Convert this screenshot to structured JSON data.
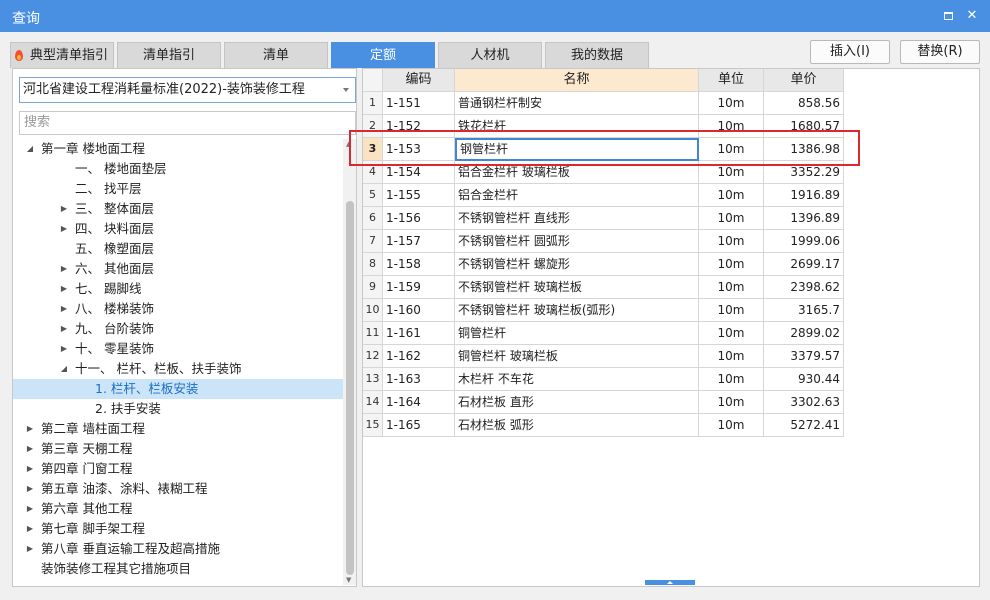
{
  "window": {
    "title": "查询",
    "maximize_icon": "maximize-icon",
    "close_icon": "close-icon",
    "close_glyph": "✕"
  },
  "tabs": [
    {
      "label": "典型清单指引",
      "icon": "fire-icon"
    },
    {
      "label": "清单指引"
    },
    {
      "label": "清单"
    },
    {
      "label": "定额",
      "active": true
    },
    {
      "label": "人材机"
    },
    {
      "label": "我的数据"
    }
  ],
  "actions": {
    "insert": "插入(I)",
    "replace": "替换(R)"
  },
  "left": {
    "standard_select": "河北省建设工程消耗量标准(2022)-装饰装修工程",
    "search_placeholder": "搜索",
    "tree": [
      {
        "label": "第一章 楼地面工程",
        "arrow": "expanded"
      },
      {
        "label": "一、 楼地面垫层",
        "arrow": "none"
      },
      {
        "label": "二、 找平层",
        "arrow": "none"
      },
      {
        "label": "三、 整体面层",
        "arrow": "collapsed"
      },
      {
        "label": "四、 块料面层",
        "arrow": "collapsed"
      },
      {
        "label": "五、 橡塑面层",
        "arrow": "none"
      },
      {
        "label": "六、 其他面层",
        "arrow": "collapsed"
      },
      {
        "label": "七、 踢脚线",
        "arrow": "collapsed"
      },
      {
        "label": "八、 楼梯装饰",
        "arrow": "collapsed"
      },
      {
        "label": "九、 台阶装饰",
        "arrow": "collapsed"
      },
      {
        "label": "十、 零星装饰",
        "arrow": "collapsed"
      },
      {
        "label": "十一、 栏杆、栏板、扶手装饰",
        "arrow": "expanded"
      },
      {
        "label": "1. 栏杆、栏板安装",
        "arrow": "none",
        "selected": true
      },
      {
        "label": "2. 扶手安装",
        "arrow": "none"
      },
      {
        "label": "第二章 墙柱面工程",
        "arrow": "collapsed"
      },
      {
        "label": "第三章 天棚工程",
        "arrow": "collapsed"
      },
      {
        "label": "第四章 门窗工程",
        "arrow": "collapsed"
      },
      {
        "label": "第五章 油漆、涂料、裱糊工程",
        "arrow": "collapsed"
      },
      {
        "label": "第六章 其他工程",
        "arrow": "collapsed"
      },
      {
        "label": "第七章 脚手架工程",
        "arrow": "collapsed"
      },
      {
        "label": "第八章 垂直运输工程及超高措施",
        "arrow": "collapsed"
      },
      {
        "label": "装饰装修工程其它措施项目",
        "arrow": "none"
      }
    ]
  },
  "table": {
    "headers": {
      "code": "编码",
      "name": "名称",
      "unit": "单位",
      "price": "单价"
    },
    "current_row": 3,
    "rows": [
      {
        "idx": "1",
        "code": "1-151",
        "name": "普通钢栏杆制安",
        "unit": "10m",
        "price": "858.56"
      },
      {
        "idx": "2",
        "code": "1-152",
        "name": "铁花栏杆",
        "unit": "10m",
        "price": "1680.57"
      },
      {
        "idx": "3",
        "code": "1-153",
        "name": "钢管栏杆",
        "unit": "10m",
        "price": "1386.98"
      },
      {
        "idx": "4",
        "code": "1-154",
        "name": "铝合金栏杆 玻璃栏板",
        "unit": "10m",
        "price": "3352.29"
      },
      {
        "idx": "5",
        "code": "1-155",
        "name": "铝合金栏杆",
        "unit": "10m",
        "price": "1916.89"
      },
      {
        "idx": "6",
        "code": "1-156",
        "name": "不锈钢管栏杆 直线形",
        "unit": "10m",
        "price": "1396.89"
      },
      {
        "idx": "7",
        "code": "1-157",
        "name": "不锈钢管栏杆 圆弧形",
        "unit": "10m",
        "price": "1999.06"
      },
      {
        "idx": "8",
        "code": "1-158",
        "name": "不锈钢管栏杆 螺旋形",
        "unit": "10m",
        "price": "2699.17"
      },
      {
        "idx": "9",
        "code": "1-159",
        "name": "不锈钢管栏杆 玻璃栏板",
        "unit": "10m",
        "price": "2398.62"
      },
      {
        "idx": "10",
        "code": "1-160",
        "name": "不锈钢管栏杆 玻璃栏板(弧形)",
        "unit": "10m",
        "price": "3165.7"
      },
      {
        "idx": "11",
        "code": "1-161",
        "name": "铜管栏杆",
        "unit": "10m",
        "price": "2899.02"
      },
      {
        "idx": "12",
        "code": "1-162",
        "name": "铜管栏杆 玻璃栏板",
        "unit": "10m",
        "price": "3379.57"
      },
      {
        "idx": "13",
        "code": "1-163",
        "name": "木栏杆 不车花",
        "unit": "10m",
        "price": "930.44"
      },
      {
        "idx": "14",
        "code": "1-164",
        "name": "石材栏板 直形",
        "unit": "10m",
        "price": "3302.63"
      },
      {
        "idx": "15",
        "code": "1-165",
        "name": "石材栏板 弧形",
        "unit": "10m",
        "price": "5272.41"
      }
    ]
  },
  "colors": {
    "accent": "#4a90e2",
    "highlight_frame": "#d9282f",
    "tree_selected": "#cce4f7"
  }
}
